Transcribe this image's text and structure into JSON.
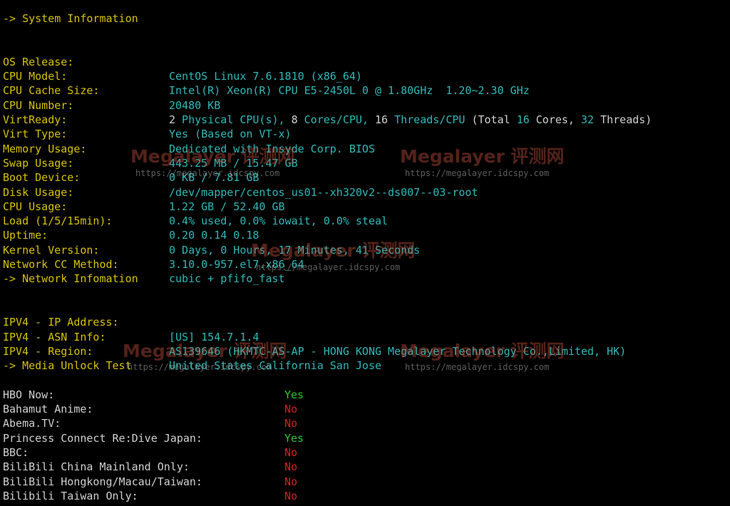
{
  "system": {
    "header": "-> System Information",
    "os_label": "OS Release:",
    "os_value": "CentOS Linux 7.6.1810 (x86_64)",
    "cpu_model_label": "CPU Model:",
    "cpu_model_value": "Intel(R) Xeon(R) CPU E5-2450L 0 @ 1.80GHz  1.20~2.30 GHz",
    "cache_label": "CPU Cache Size:",
    "cache_value": "20480 KB",
    "cpu_num_label": "CPU Number:",
    "cpu_num": {
      "p1": "2",
      "p2": " Physical CPU(s), ",
      "p3": "8",
      "p4": " Cores/CPU, ",
      "p5": "16",
      "p6": " Threads/CPU ",
      "p7": "(Total ",
      "p8": "16",
      "p9": " Cores, ",
      "p10": "32",
      "p11": " Threads)"
    },
    "virt_ready_label": "VirtReady:",
    "virt_ready_value": "Yes (Based on VT-x)",
    "virt_type_label": "Virt Type:",
    "virt_type_value": "Dedicated with Insyde Corp. BIOS",
    "mem_label": "Memory Usage:",
    "mem_value": "443.25 MB / 15.47 GB",
    "swap_label": "Swap Usage:",
    "swap_value": "0 KB / 7.81 GB",
    "boot_label": "Boot Device:",
    "boot_value": "/dev/mapper/centos_us01--xh320v2--ds007--03-root",
    "disk_label": "Disk Usage:",
    "disk_value": "1.22 GB / 52.40 GB",
    "cpu_usage_label": "CPU Usage:",
    "cpu_usage_value": "0.4% used, 0.0% iowait, 0.0% steal",
    "load_label": "Load (1/5/15min):",
    "load_value": "0.20 0.14 0.18",
    "uptime_label": "Uptime:",
    "uptime_value": "0 Days, 0 Hours, 17 Minutes, 41 Seconds",
    "kernel_label": "Kernel Version:",
    "kernel_value": "3.10.0-957.el7.x86_64",
    "cc_label": "Network CC Method:",
    "cc_value": "cubic + pfifo_fast"
  },
  "network": {
    "header": "-> Network Infomation",
    "ip_label": "IPV4 - IP Address:",
    "ip_value": "[US] 154.7.1.4",
    "asn_label": "IPV4 - ASN Info:",
    "asn_value": "AS139646 (HKMTC-AS-AP - HONG KONG Megalayer Technology Co.,Limited, HK)",
    "region_label": "IPV4 - Region:",
    "region_value": "United States California San Jose"
  },
  "media": {
    "header": "-> Media Unlock Test",
    "items": [
      {
        "label": "HBO Now:",
        "value": "Yes"
      },
      {
        "label": "Bahamut Anime:",
        "value": "No"
      },
      {
        "label": "Abema.TV:",
        "value": "No"
      },
      {
        "label": "Princess Connect Re:Dive Japan:",
        "value": "Yes"
      },
      {
        "label": "BBC:",
        "value": "No"
      },
      {
        "label": "BiliBili China Mainland Only:",
        "value": "No"
      },
      {
        "label": "BiliBili Hongkong/Macau/Taiwan:",
        "value": "No"
      },
      {
        "label": "Bilibili Taiwan Only:",
        "value": "No"
      }
    ]
  },
  "colors": {
    "yes": "#2ec52e",
    "no": "#d42020",
    "label": "#d6c100",
    "value": "#2fb8b8"
  },
  "watermark": {
    "brand": "Megalayer 评测网",
    "url": "https://megalayer.idcspy.com"
  }
}
